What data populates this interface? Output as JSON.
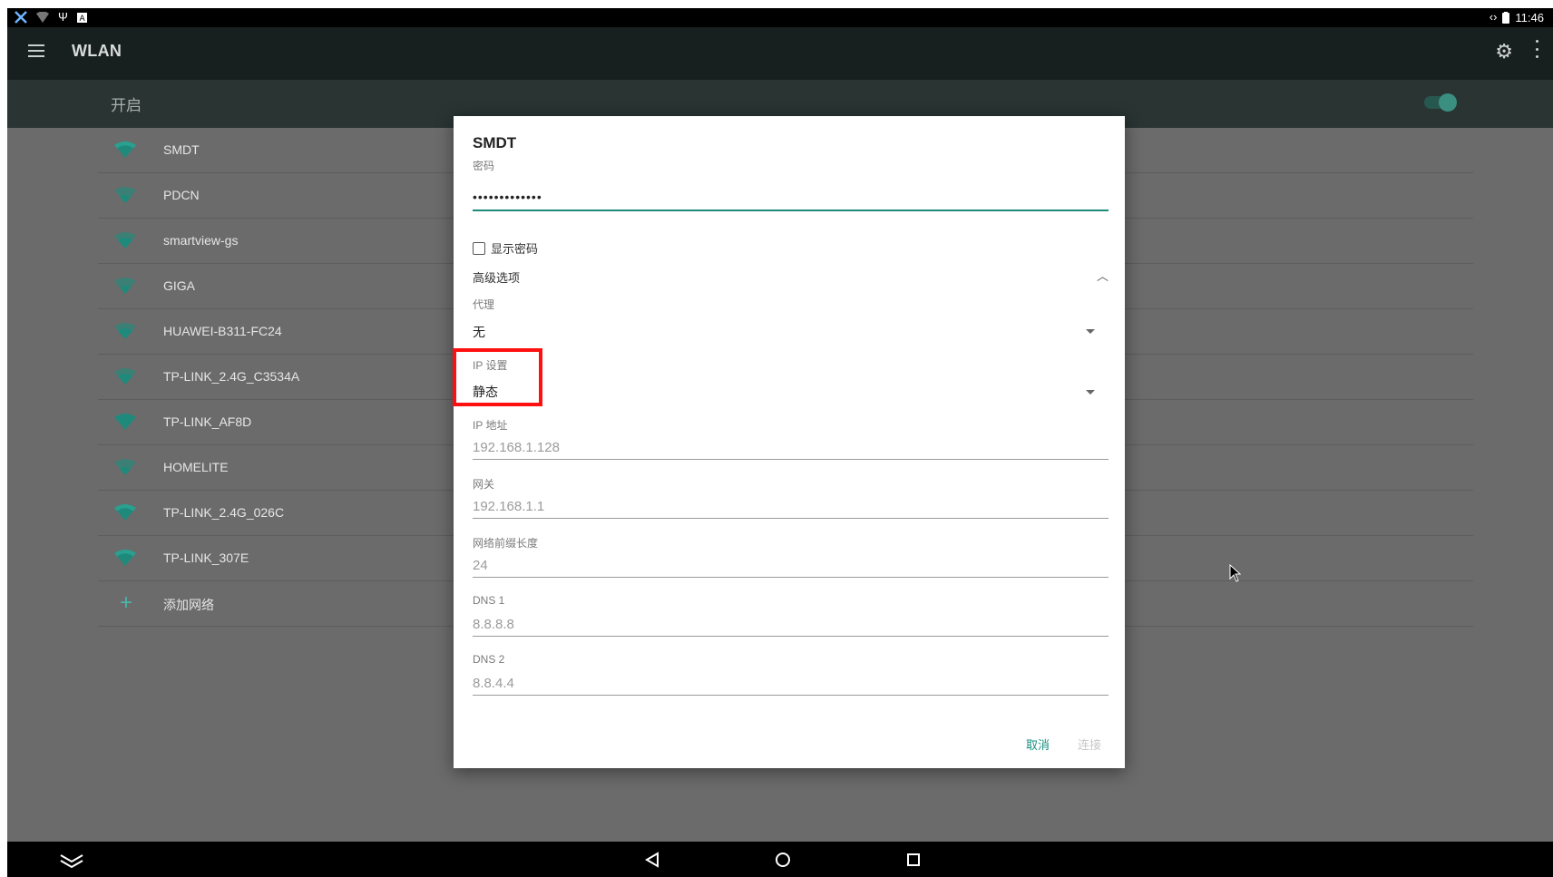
{
  "status_bar": {
    "icons_left": [
      "tools-icon",
      "wifi-weak-icon",
      "usb-icon",
      "notification-a-icon"
    ],
    "icons_right": [
      "data-arrows-icon",
      "battery-icon"
    ],
    "time": "11:46"
  },
  "app_bar": {
    "title": "WLAN"
  },
  "switch_bar": {
    "label": "开启",
    "enabled": true
  },
  "networks": [
    {
      "name": "SMDT"
    },
    {
      "name": "PDCN"
    },
    {
      "name": "smartview-gs"
    },
    {
      "name": "GIGA"
    },
    {
      "name": "HUAWEI-B311-FC24"
    },
    {
      "name": "TP-LINK_2.4G_C3534A"
    },
    {
      "name": "TP-LINK_AF8D"
    },
    {
      "name": "HOMELITE"
    },
    {
      "name": "TP-LINK_2.4G_026C"
    },
    {
      "name": "TP-LINK_307E"
    }
  ],
  "add_network": "添加网络",
  "dialog": {
    "title": "SMDT",
    "password_label": "密码",
    "password_value": "•••••••••••••",
    "show_password_label": "显示密码",
    "advanced_label": "高级选项",
    "proxy_label": "代理",
    "proxy_value": "无",
    "ip_settings_label": "IP 设置",
    "ip_settings_value": "静态",
    "ip_address_label": "IP 地址",
    "ip_address_value": "192.168.1.128",
    "gateway_label": "网关",
    "gateway_value": "192.168.1.1",
    "prefix_label": "网络前缀长度",
    "prefix_value": "24",
    "dns1_label": "DNS 1",
    "dns1_value": "8.8.8.8",
    "dns2_label": "DNS 2",
    "dns2_value": "8.8.4.4",
    "cancel_label": "取消",
    "connect_label": "连接"
  },
  "colors": {
    "accent": "#1f8a7b",
    "highlight": "#ff1010",
    "app_bar": "#18201f",
    "switch_bar": "#293433"
  }
}
